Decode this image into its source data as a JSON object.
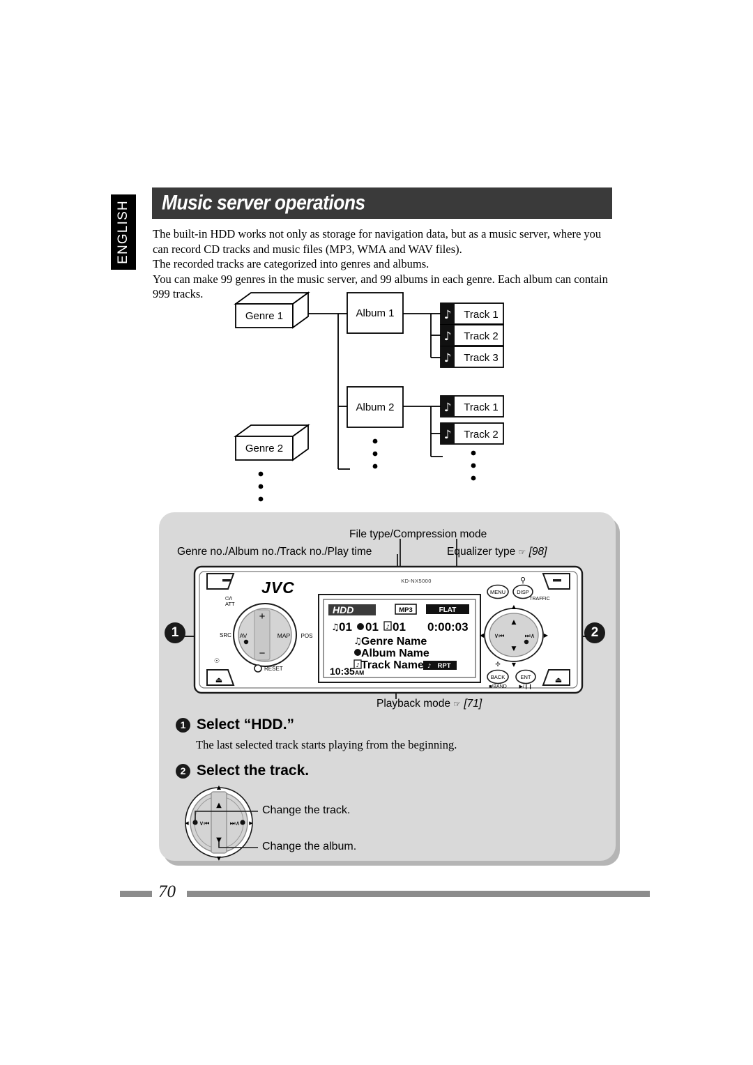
{
  "language_tab": "ENGLISH",
  "page_title": "Music server operations",
  "intro": {
    "line1": "The built-in HDD works not only as storage for navigation data, but as a music server, where you",
    "line2": "can record CD tracks and music files (MP3, WMA and WAV files).",
    "line3": "The recorded tracks are categorized into genres and albums.",
    "line4": "You can make 99 genres in the music server, and 99 albums in each genre. Each album can contain",
    "line5": "999 tracks."
  },
  "hierarchy": {
    "genres": [
      "Genre 1",
      "Genre 2"
    ],
    "albums": [
      "Album 1",
      "Album 2"
    ],
    "album1_tracks": [
      "Track 1",
      "Track 2",
      "Track 3"
    ],
    "album2_tracks": [
      "Track 1",
      "Track 2"
    ],
    "note_icon": "music-note-icon",
    "ellipsis": "•"
  },
  "callouts": {
    "file_type": "File type/Compression mode",
    "genre_album_track": "Genre no./Album no./Track no./Play time",
    "equalizer": "Equalizer type",
    "equalizer_ref": "[98]",
    "playback_mode": "Playback mode",
    "playback_ref": "[71]",
    "hand_icon": "☞"
  },
  "markers": {
    "left": "1",
    "right": "2"
  },
  "unit": {
    "brand": "JVC",
    "model": "KD-NX5000",
    "left_controls": {
      "power_att": "⏻/I\nATT",
      "power_label": "⏻/I",
      "att_label": "ATT",
      "src": "SRC",
      "av": "AV",
      "map": "MAP",
      "pos": "POS",
      "plus": "+",
      "minus": "−",
      "reset": "RESET",
      "eject": "⏏",
      "detach": "⏏"
    },
    "right_controls": {
      "menu": "MENU",
      "disp": "DISP",
      "search_icon": "search-icon",
      "traffic": "TRAFFIC",
      "back": "BACK",
      "back_sub": "■/BAND",
      "ent": "ENT",
      "ent_sub": "▶/❙❙",
      "prev": "∨⏮",
      "next": "⏭∧"
    },
    "display": {
      "source": "HDD",
      "file_type": "MP3",
      "equalizer": "FLAT",
      "genre_no": "01",
      "album_no": "01",
      "track_no": "01",
      "play_time": "0:00:03",
      "genre_name": "Genre Name",
      "album_name": "Album Name",
      "track_name": "Track Name",
      "repeat": "RPT",
      "clock": "10:35",
      "clock_suffix": "AM"
    }
  },
  "steps": [
    {
      "number": "1",
      "title": "Select “HDD.”",
      "description": "The last selected track starts playing from the beginning."
    },
    {
      "number": "2",
      "title": "Select the track.",
      "note_track": "Change the track.",
      "note_album": "Change the album."
    }
  ],
  "footer": {
    "page_number": "70"
  },
  "colors": {
    "title_bar": "#3a3a3a",
    "panel": "#d9d9d9",
    "footer_bar": "#8c8c8c",
    "tab": "#000000"
  }
}
